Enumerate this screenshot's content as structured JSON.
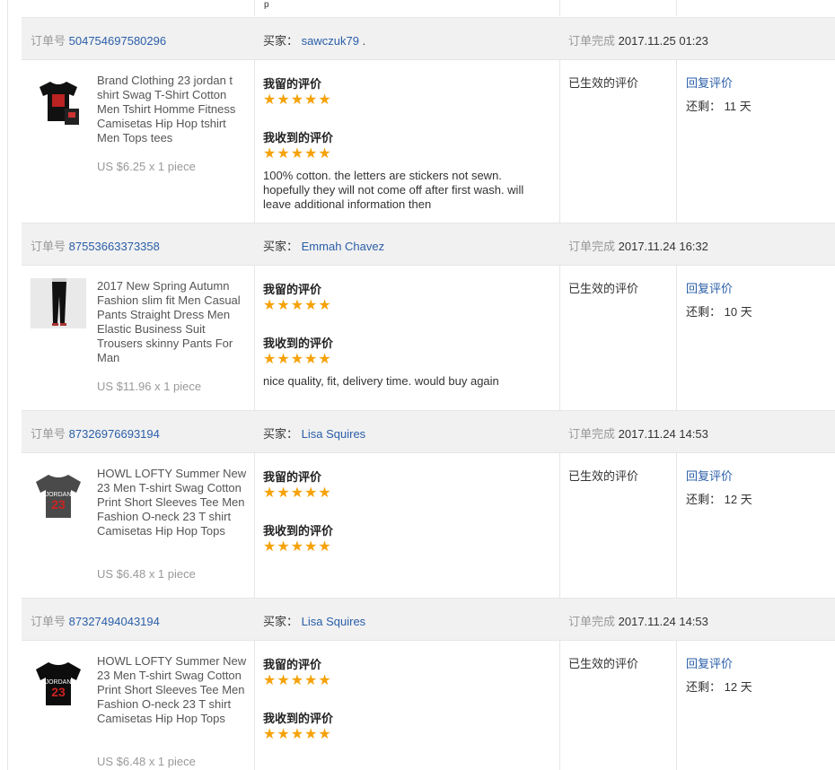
{
  "labels": {
    "order_no": "订单号",
    "buyer": "买家：",
    "completed": "订单完成",
    "my_review": "我留的评价",
    "received_review": "我收到的评价",
    "effective": "已生效的评价",
    "reply": "回复评价",
    "remaining": "还剩：",
    "days_unit": "天"
  },
  "top_stub_text": "p",
  "orders": [
    {
      "order_no": "504754697580296",
      "buyer": "sawczuk79",
      "buyer_suffix": ".",
      "completed_at": "2017.11.25 01:23",
      "product_title": "Brand Clothing 23 jordan t shirt Swag T-Shirt Cotton Men Tshirt Homme Fitness Camisetas Hip Hop tshirt Men Tops tees",
      "price": "US $6.25 x 1 piece",
      "my_rating": 5,
      "received_rating": 5,
      "received_text": "100% cotton. the letters are stickers not sewn. hopefully they will not come off after first wash. will leave additional information then",
      "remaining_days": "11",
      "thumb_icon": "black-tshirt-icon"
    },
    {
      "order_no": "87553663373358",
      "buyer": "Emmah Chavez",
      "buyer_suffix": "",
      "completed_at": "2017.11.24 16:32",
      "product_title": "2017 New Spring Autumn Fashion slim fit Men Casual Pants Straight Dress Men Elastic Business Suit Trousers skinny Pants For Man",
      "price": "US $11.96 x 1 piece",
      "my_rating": 5,
      "received_rating": 5,
      "received_text": "nice quality, fit, delivery time. would buy again",
      "remaining_days": "10",
      "thumb_icon": "trousers-model-icon"
    },
    {
      "order_no": "87326976693194",
      "buyer": "Lisa Squires",
      "buyer_suffix": "",
      "completed_at": "2017.11.24 14:53",
      "product_title": "HOWL LOFTY Summer New 23 Men T-shirt Swag Cotton Print Short Sleeves Tee Men Fashion O-neck 23 T shirt Camisetas Hip Hop Tops",
      "price": "US $6.48 x 1 piece",
      "my_rating": 5,
      "received_rating": 5,
      "received_text": "",
      "remaining_days": "12",
      "thumb_icon": "grey-tshirt-icon"
    },
    {
      "order_no": "87327494043194",
      "buyer": "Lisa Squires",
      "buyer_suffix": "",
      "completed_at": "2017.11.24 14:53",
      "product_title": "HOWL LOFTY Summer New 23 Men T-shirt Swag Cotton Print Short Sleeves Tee Men Fashion O-neck 23 T shirt Camisetas Hip Hop Tops",
      "price": "US $6.48 x 1 piece",
      "my_rating": 5,
      "received_rating": 5,
      "received_text": "",
      "remaining_days": "12",
      "thumb_icon": "black-tshirt-icon"
    }
  ]
}
